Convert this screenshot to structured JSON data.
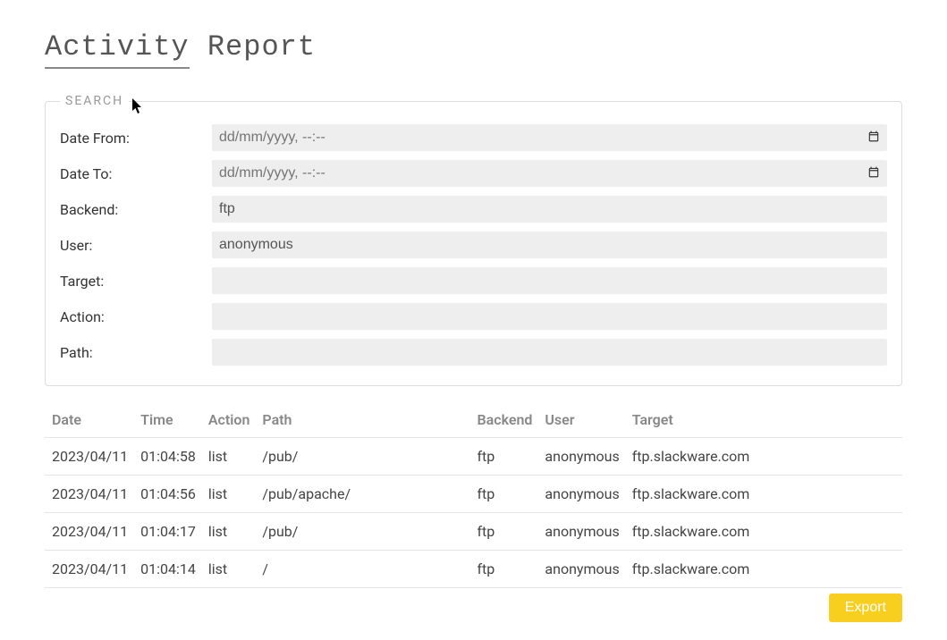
{
  "page_title_part1": "Activity",
  "page_title_part2": " Report",
  "search": {
    "legend": "SEARCH",
    "labels": {
      "date_from": "Date From:",
      "date_to": "Date To:",
      "backend": "Backend:",
      "user": "User:",
      "target": "Target:",
      "action": "Action:",
      "path": "Path:"
    },
    "placeholders": {
      "date_from": "dd/mm/yyyy, --:--",
      "date_to": "dd/mm/yyyy, --:--"
    },
    "values": {
      "date_from": "",
      "date_to": "",
      "backend": "ftp",
      "user": "anonymous",
      "target": "",
      "action": "",
      "path": ""
    }
  },
  "table": {
    "headers": {
      "date": "Date",
      "time": "Time",
      "action": "Action",
      "path": "Path",
      "backend": "Backend",
      "user": "User",
      "target": "Target"
    },
    "rows": [
      {
        "date": "2023/04/11",
        "time": "01:04:58",
        "action": "list",
        "path": "/pub/",
        "backend": "ftp",
        "user": "anonymous",
        "target": "ftp.slackware.com"
      },
      {
        "date": "2023/04/11",
        "time": "01:04:56",
        "action": "list",
        "path": "/pub/apache/",
        "backend": "ftp",
        "user": "anonymous",
        "target": "ftp.slackware.com"
      },
      {
        "date": "2023/04/11",
        "time": "01:04:17",
        "action": "list",
        "path": "/pub/",
        "backend": "ftp",
        "user": "anonymous",
        "target": "ftp.slackware.com"
      },
      {
        "date": "2023/04/11",
        "time": "01:04:14",
        "action": "list",
        "path": "/",
        "backend": "ftp",
        "user": "anonymous",
        "target": "ftp.slackware.com"
      }
    ]
  },
  "export_button": "Export"
}
